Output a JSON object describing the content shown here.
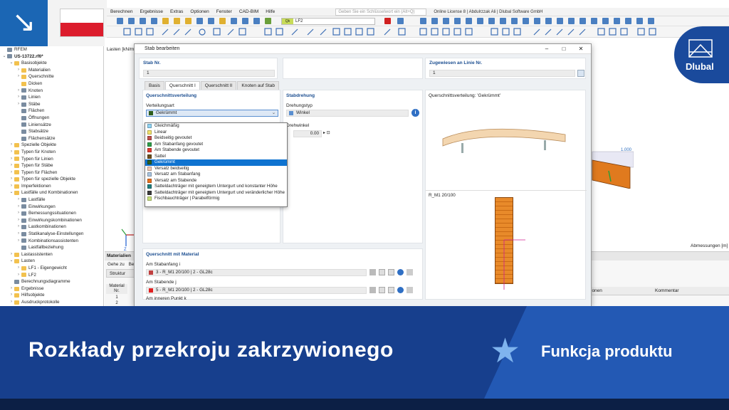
{
  "menu": {
    "items": [
      "Berechnen",
      "Ergebnisse",
      "Extras",
      "Optionen",
      "Fenster",
      "CAD-BIM",
      "Hilfe"
    ],
    "search_placeholder": "Geben Sie ein Schlüsselwort ein (Alt+Q)",
    "license": "Online License 8 | Abdulrzzak Ali | Dlubal Software GmbH"
  },
  "toolbar": {
    "loadcase_code": "Qk",
    "loadcase": "LF2"
  },
  "navigator": {
    "items": [
      {
        "label": "RFEM",
        "lvl": 0,
        "ico": "gray",
        "arr": ""
      },
      {
        "label": "US-13722.rf6*",
        "lvl": 0,
        "ico": "gray",
        "arr": "⌄",
        "bold": true
      },
      {
        "label": "Basisobjekte",
        "lvl": 1,
        "ico": "fold",
        "arr": "⌄"
      },
      {
        "label": "Materialien",
        "lvl": 2,
        "ico": "fold",
        "arr": "›"
      },
      {
        "label": "Querschnitte",
        "lvl": 2,
        "ico": "fold",
        "arr": "›"
      },
      {
        "label": "Dicken",
        "lvl": 2,
        "ico": "fold",
        "arr": ""
      },
      {
        "label": "Knoten",
        "lvl": 2,
        "ico": "gray",
        "arr": "›"
      },
      {
        "label": "Linien",
        "lvl": 2,
        "ico": "gray",
        "arr": "›"
      },
      {
        "label": "Stäbe",
        "lvl": 2,
        "ico": "gray",
        "arr": "›"
      },
      {
        "label": "Flächen",
        "lvl": 2,
        "ico": "gray",
        "arr": ""
      },
      {
        "label": "Öffnungen",
        "lvl": 2,
        "ico": "gray",
        "arr": ""
      },
      {
        "label": "Liniensätze",
        "lvl": 2,
        "ico": "gray",
        "arr": ""
      },
      {
        "label": "Stabsätze",
        "lvl": 2,
        "ico": "gray",
        "arr": ""
      },
      {
        "label": "Flächensätze",
        "lvl": 2,
        "ico": "gray",
        "arr": ""
      },
      {
        "label": "Spezielle Objekte",
        "lvl": 1,
        "ico": "fold",
        "arr": "›"
      },
      {
        "label": "Typen für Knoten",
        "lvl": 1,
        "ico": "fold",
        "arr": "›"
      },
      {
        "label": "Typen für Linien",
        "lvl": 1,
        "ico": "fold",
        "arr": "›"
      },
      {
        "label": "Typen für Stäbe",
        "lvl": 1,
        "ico": "fold",
        "arr": "›"
      },
      {
        "label": "Typen für Flächen",
        "lvl": 1,
        "ico": "fold",
        "arr": "›"
      },
      {
        "label": "Typen für spezielle Objekte",
        "lvl": 1,
        "ico": "fold",
        "arr": "›"
      },
      {
        "label": "Imperfektionen",
        "lvl": 1,
        "ico": "fold",
        "arr": "›"
      },
      {
        "label": "Lastfälle und Kombinationen",
        "lvl": 1,
        "ico": "fold",
        "arr": "⌄"
      },
      {
        "label": "Lastfälle",
        "lvl": 2,
        "ico": "gray",
        "arr": "›"
      },
      {
        "label": "Einwirkungen",
        "lvl": 2,
        "ico": "gray",
        "arr": "›"
      },
      {
        "label": "Bemessungssituationen",
        "lvl": 2,
        "ico": "gray",
        "arr": "›"
      },
      {
        "label": "Einwirkungskombinationen",
        "lvl": 2,
        "ico": "gray",
        "arr": "›"
      },
      {
        "label": "Lastkombinationen",
        "lvl": 2,
        "ico": "gray",
        "arr": "›"
      },
      {
        "label": "Statikanalyse-Einstellungen",
        "lvl": 2,
        "ico": "gray",
        "arr": "›"
      },
      {
        "label": "Kombinationsassistenten",
        "lvl": 2,
        "ico": "gray",
        "arr": "›"
      },
      {
        "label": "Lastfallbeziehung",
        "lvl": 2,
        "ico": "gray",
        "arr": ""
      },
      {
        "label": "Lastassistenten",
        "lvl": 1,
        "ico": "fold",
        "arr": "›"
      },
      {
        "label": "Lasten",
        "lvl": 1,
        "ico": "fold",
        "arr": "⌄"
      },
      {
        "label": "LF1 - Eigengewicht",
        "lvl": 2,
        "ico": "fold",
        "arr": "›"
      },
      {
        "label": "LF2",
        "lvl": 2,
        "ico": "fold",
        "arr": "›"
      },
      {
        "label": "Berechnungsdiagramme",
        "lvl": 1,
        "ico": "gray",
        "arr": ""
      },
      {
        "label": "Ergebnisse",
        "lvl": 1,
        "ico": "fold",
        "arr": "›"
      },
      {
        "label": "Hilfsobjekte",
        "lvl": 1,
        "ico": "fold",
        "arr": "›"
      },
      {
        "label": "Ausdruckprotokolle",
        "lvl": 1,
        "ico": "fold",
        "arr": "›"
      }
    ]
  },
  "graphics": {
    "load_label": "Lasten [kN/m²]",
    "dimension_label": "Abmessungen [m]",
    "value_label": "1.000",
    "axis_z": "Z"
  },
  "bottom": {
    "header": "Materialien",
    "goto": "Gehe zu",
    "edit": "Bea",
    "structure": "Struktur",
    "col_material": "Material",
    "col_nr": "Nr.",
    "rows": [
      "1",
      "2"
    ],
    "col_ionen": "ionen",
    "col_comment": "Kommentar"
  },
  "dialog": {
    "title": "Stab bearbeiten",
    "stab_nr_label": "Stab Nr.",
    "stab_nr": "1",
    "assigned_label": "Zugewiesen an Linie Nr.",
    "assigned": "1",
    "tabs": [
      "Basis",
      "Querschnitt I",
      "Querschnitt II",
      "Knoten auf Stab"
    ],
    "distribution_section": "Querschnittsverteilung",
    "distribution_type_label": "Verteilungsart",
    "distribution_value": "Gekrümmt",
    "options": [
      {
        "label": "Gleichmäßig",
        "color": "#8fd3f4"
      },
      {
        "label": "Linear",
        "color": "#f2e26b"
      },
      {
        "label": "Beidseitig gevoutet",
        "color": "#c0504d"
      },
      {
        "label": "Am Stabanfang gevoutet",
        "color": "#2e9e4a"
      },
      {
        "label": "Am Stabende gevoutet",
        "color": "#e03a2f"
      },
      {
        "label": "Sattel",
        "color": "#6b4f1d"
      },
      {
        "label": "Gekrümmt",
        "color": "#2d5d1c"
      },
      {
        "label": "Versatz beidseitig",
        "color": "#f0c8b4"
      },
      {
        "label": "Versatz am Stabanfang",
        "color": "#a8c4e0"
      },
      {
        "label": "Versatz am Stabende",
        "color": "#e8701e"
      },
      {
        "label": "Satteldachträger mit geneigtem Untergurt und konstanter Höhe",
        "color": "#1e7f7f"
      },
      {
        "label": "Satteldachträger mit geneigtem Untergurt und veränderlicher Höhe",
        "color": "#3c3c3c"
      },
      {
        "label": "Fischbauchträger | Parabelförmig",
        "color": "#c8e07a"
      }
    ],
    "selected_index": 6,
    "rotation_section": "Stabdrehung",
    "rotation_type_label": "Drehungstyp",
    "rotation_type": "Winkel",
    "rotation_angle_label": "Drehwinkel",
    "rotation_angle": "0.00",
    "preview_title": "Querschnittsverteilung: 'Gekrümmt'",
    "preview_section": "R_M1 20/100",
    "material_section": "Querschnitt mit Material",
    "start_label": "Am Stabanfang i",
    "start_value": "3 - R_M1 20/100 | 2 - GL28c",
    "end_label": "Am Stabende j",
    "end_value": "5 - R_M1 20/100 | 2 - GL28c",
    "inner_label": "Am inneren Punkt k"
  },
  "banner": {
    "title": "Rozkłady przekroju zakrzywionego",
    "feature": "Funkcja produktu"
  },
  "logo": "Dlubal",
  "colors": {
    "banner_dark": "#173f8d",
    "banner_light": "#2359b4",
    "selection": "#0f73d0",
    "timber": "#e88a2a"
  }
}
